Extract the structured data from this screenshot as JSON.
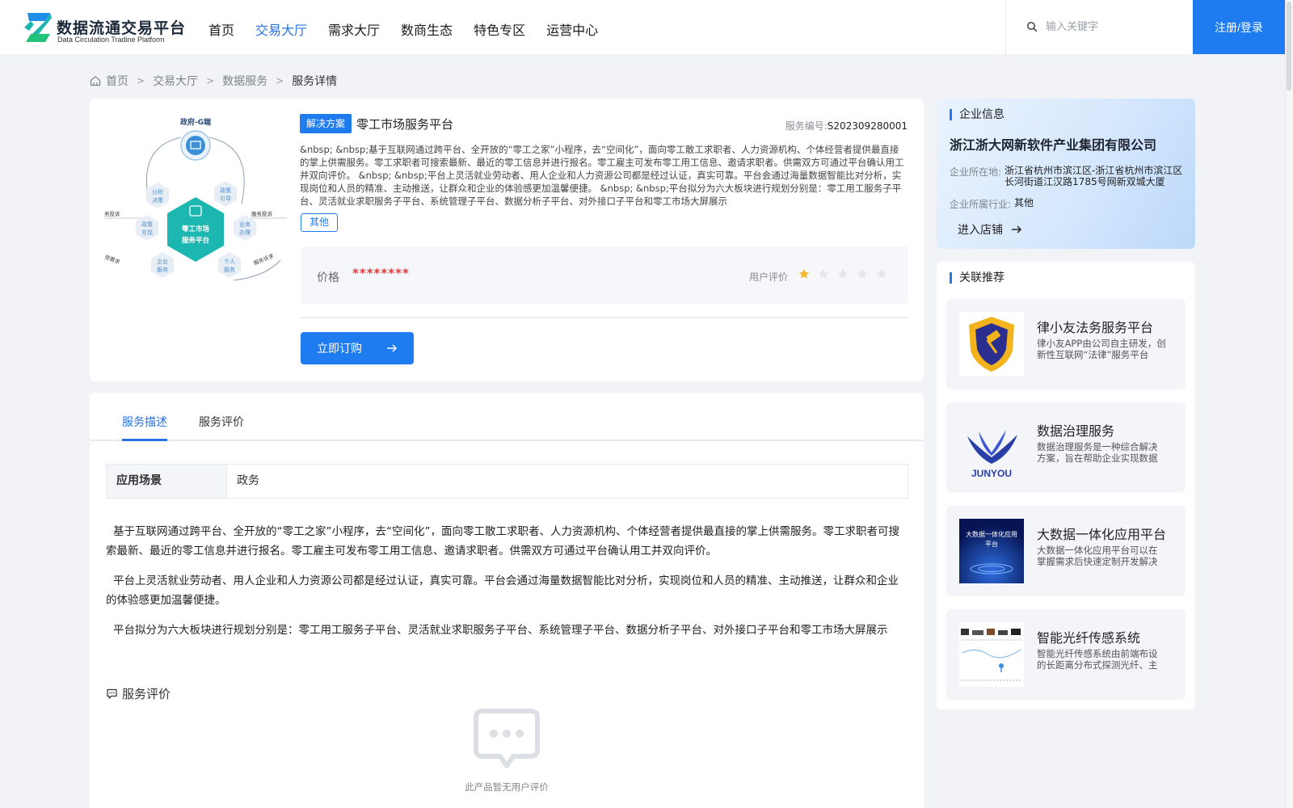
{
  "nav": {
    "logo_title": "数据流通交易平台",
    "logo_subtitle": "Data Circulation Tradine Platform",
    "menu": [
      "首页",
      "交易大厅",
      "需求大厅",
      "数商生态",
      "特色专区",
      "运营中心"
    ],
    "active_menu": "交易大厅",
    "search_placeholder": "输入关键字",
    "login_label": "注册/登录"
  },
  "breadcrumb": [
    "首页",
    "交易大厅",
    "数据服务",
    "服务详情"
  ],
  "service": {
    "tag": "解决方案",
    "title": "零工市场服务平台",
    "number_label": "服务编号:",
    "number": "S202309280001",
    "description": "&nbsp; &nbsp;基于互联网通过跨平台、全开放的“零工之家”小程序，去“空间化”，面向零工散工求职者、人力资源机构、个体经营者提供最直接的掌上供需服务。零工求职者可搜索最新、最近的零工信息并进行报名。零工雇主可发布零工用工信息、邀请求职者。供需双方可通过平台确认用工并双向评价。 &nbsp; &nbsp;平台上灵活就业劳动者、用人企业和人力资源公司都是经过认证，真实可靠。平台会通过海量数据智能比对分析，实现岗位和人员的精准、主动推送，让群众和企业的体验感更加温馨便捷。 &nbsp; &nbsp;平台拟分为六大板块进行规划分别是：零工用工服务子平台、灵活就业求职服务子平台、系统管理子平台、数据分析子平台、对外接口子平台和零工市场大屏展示",
    "category_tag": "其他",
    "price_label": "价格",
    "price_value": "********",
    "rating_label": "用户评价",
    "rating": 1,
    "rating_max": 5,
    "subscribe_label": "立即订购"
  },
  "diagram": {
    "top": "政府-G端",
    "center_line1": "零工市场",
    "center_line2": "服务平台",
    "left_top_1": "分析",
    "left_top_2": "决策",
    "right_top_1": "政策",
    "right_top_2": "引导",
    "left_mid_1": "政策",
    "left_mid_2": "兑现",
    "right_mid_1": "业务",
    "right_mid_2": "办理",
    "left_bot_1": "企业",
    "left_bot_2": "服务",
    "right_bot_1": "个人",
    "right_bot_2": "服务",
    "edge_left": "务投诉",
    "edge_right": "服务投诉",
    "edge_left_bot": "劳需求",
    "edge_right_bot": "服务诉求"
  },
  "detail": {
    "tabs": [
      "服务描述",
      "服务评价"
    ],
    "active_tab": "服务描述",
    "scene_label": "应用场景",
    "scene_value": "政务",
    "paragraphs": [
      "基于互联网通过跨平台、全开放的“零工之家”小程序，去“空间化”，面向零工散工求职者、人力资源机构、个体经营者提供最直接的掌上供需服务。零工求职者可搜索最新、最近的零工信息并进行报名。零工雇主可发布零工用工信息、邀请求职者。供需双方可通过平台确认用工并双向评价。",
      "平台上灵活就业劳动者、用人企业和人力资源公司都是经过认证，真实可靠。平台会通过海量数据智能比对分析，实现岗位和人员的精准、主动推送，让群众和企业的体验感更加温馨便捷。",
      "平台拟分为六大板块进行规划分别是：零工用工服务子平台、灵活就业求职服务子平台、系统管理子平台、数据分析子平台、对外接口子平台和零工市场大屏展示"
    ],
    "eval_title": "服务评价",
    "empty_text": "此产品暂无用户评价"
  },
  "company": {
    "section_title": "企业信息",
    "name": "浙江浙大网新软件产业集团有限公司",
    "location_label": "企业所在地:",
    "location": "浙江省杭州市滨江区-浙江省杭州市滨江区长河街道江汉路1785号网新双城大厦",
    "industry_label": "企业所属行业:",
    "industry": "其他",
    "enter_label": "进入店铺"
  },
  "recommend": {
    "section_title": "关联推荐",
    "items": [
      {
        "name": "律小友法务服务平台",
        "desc": "律小友APP由公司自主研发，创新性互联网“法律”服务平台"
      },
      {
        "name": "数据治理服务",
        "desc": "数据治理服务是一种综合解决方案，旨在帮助企业实现数据资产的有效管理"
      },
      {
        "name": "大数据一体化应用平台",
        "desc": "大数据一体化应用平台可以在掌握需求后快速定制开发解决方案"
      },
      {
        "name": "智能光纤传感系统",
        "desc": "智能光纤传感系统由前端布设的长距离分布式探测光纤、主机组成"
      }
    ],
    "logo_text_2": "JUNYOU",
    "thumb_text_3": "大数据一体化应用平台"
  },
  "colors": {
    "primary": "#1e7bf0",
    "price": "#e23b3b",
    "star_on": "#f6b52a",
    "star_off": "#e4e6ea",
    "page_bg": "#f1f3f7"
  }
}
